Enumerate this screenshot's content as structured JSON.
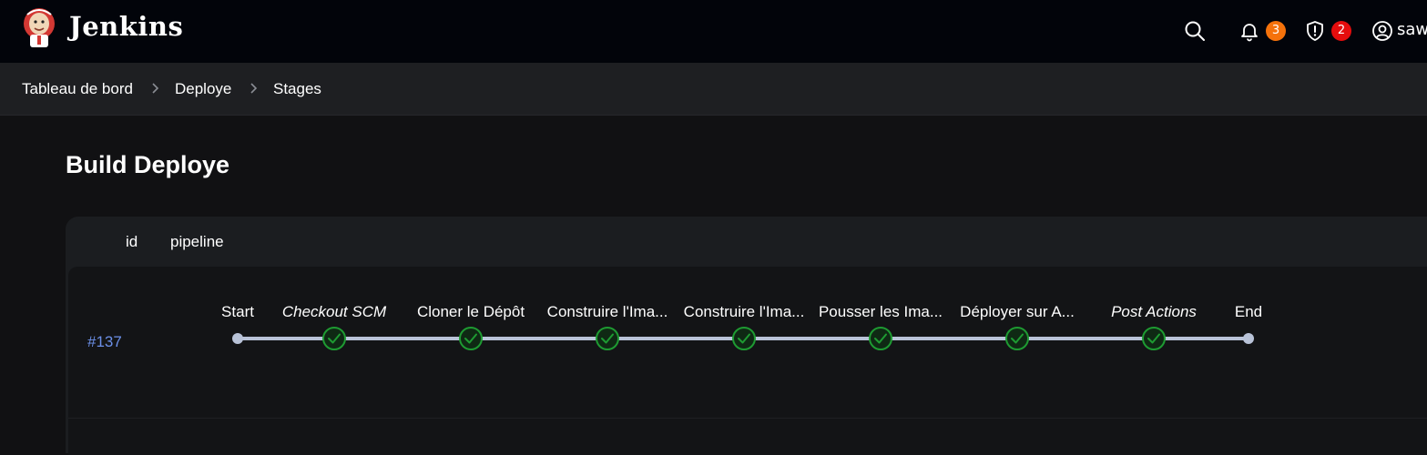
{
  "header": {
    "brand": "Jenkins",
    "notifications_count": "3",
    "security_count": "2",
    "user_name": "saw",
    "colors": {
      "notif_badge": "#f5720b",
      "security_badge": "#e50d0d",
      "bg": "#02040a"
    }
  },
  "breadcrumb": {
    "items": [
      "Tableau de bord",
      "Deploye",
      "Stages"
    ]
  },
  "page": {
    "title": "Build Deploye"
  },
  "table": {
    "headers": {
      "id": "id",
      "pipeline": "pipeline"
    },
    "rows": [
      {
        "id": "#137",
        "stages": [
          {
            "label": "Start",
            "type": "endpoint",
            "italic": false
          },
          {
            "label": "Checkout SCM",
            "type": "success",
            "italic": true
          },
          {
            "label": "Cloner le Dépôt",
            "type": "success",
            "italic": false
          },
          {
            "label": "Construire l'Ima...",
            "type": "success",
            "italic": false
          },
          {
            "label": "Construire l'Ima...",
            "type": "success",
            "italic": false
          },
          {
            "label": "Pousser les Ima...",
            "type": "success",
            "italic": false
          },
          {
            "label": "Déployer sur A...",
            "type": "success",
            "italic": false
          },
          {
            "label": "Post Actions",
            "type": "success",
            "italic": true
          },
          {
            "label": "End",
            "type": "endpoint",
            "italic": false
          }
        ]
      }
    ]
  },
  "colors": {
    "success_stroke": "#1e9b32",
    "success_fill": "#0f2914",
    "line": "#b9c3d8",
    "link": "#6c90e8"
  }
}
